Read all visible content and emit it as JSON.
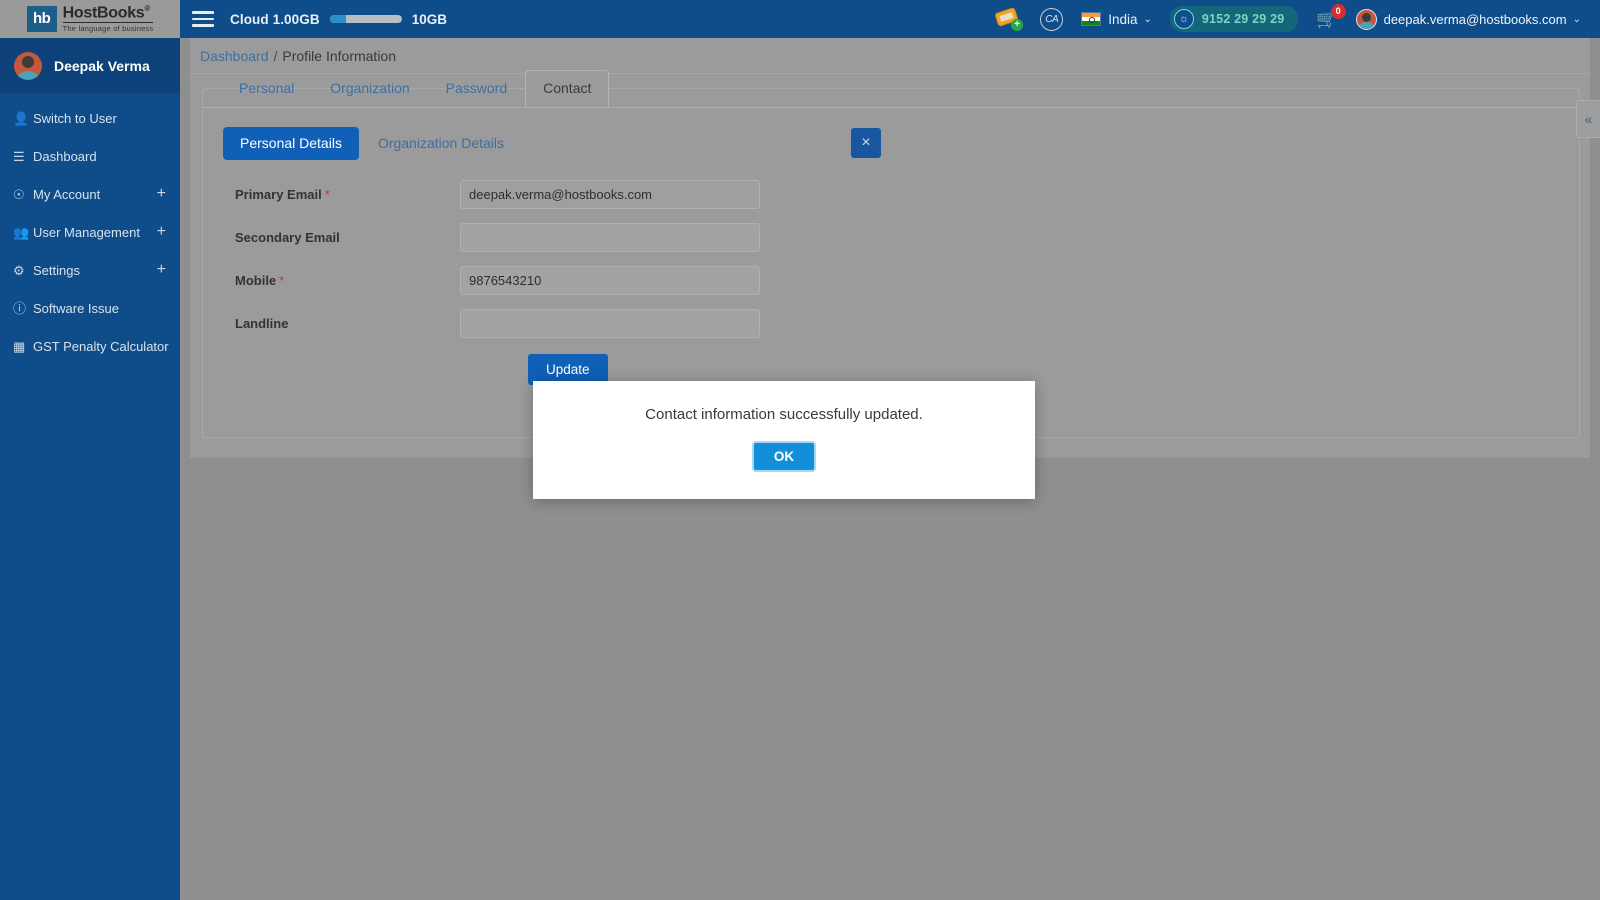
{
  "brand": {
    "mark": "hb",
    "name": "HostBooks",
    "registered": "®",
    "tagline": "The language of business"
  },
  "topbar": {
    "menu_toggle": "hamburger-menu",
    "cloud_label": "Cloud 1.00GB",
    "cloud_used_gb": 1.0,
    "cloud_total_label": "10GB",
    "cloud_total_gb": 10,
    "ticket_icon": "ticket-add-icon",
    "ca_badge": "CA",
    "country": "India",
    "country_caret": "⌄",
    "support_phone": "9152 29 29 29",
    "cart_count": "0",
    "user_email": "deepak.verma@hostbooks.com",
    "user_caret": "⌄"
  },
  "sidebar": {
    "profile_name": "Deepak Verma",
    "items": [
      {
        "label": "Switch to User",
        "icon": "user-icon",
        "glyph": "♟",
        "expandable": false
      },
      {
        "label": "Dashboard",
        "icon": "dashboard-icon",
        "glyph": "≡",
        "expandable": false
      },
      {
        "label": "My Account",
        "icon": "account-circle-icon",
        "glyph": "◉",
        "expandable": true
      },
      {
        "label": "User Management",
        "icon": "users-group-icon",
        "glyph": "⛃",
        "expandable": true
      },
      {
        "label": "Settings",
        "icon": "gear-icon",
        "glyph": "⚙",
        "expandable": true
      },
      {
        "label": "Software Issue",
        "icon": "info-circle-icon",
        "glyph": "ⓘ",
        "expandable": false
      },
      {
        "label": "GST Penalty Calculator",
        "icon": "calculator-icon",
        "glyph": "▦",
        "expandable": false
      }
    ],
    "plus_glyph": "+"
  },
  "breadcrumb": {
    "root": "Dashboard",
    "separator": "/",
    "current": "Profile Information"
  },
  "tabs": [
    {
      "label": "Personal",
      "active": false
    },
    {
      "label": "Organization",
      "active": false
    },
    {
      "label": "Password",
      "active": false
    },
    {
      "label": "Contact",
      "active": true
    }
  ],
  "subtabs": [
    {
      "label": "Personal Details",
      "active": true
    },
    {
      "label": "Organization Details",
      "active": false
    }
  ],
  "form": {
    "fields": [
      {
        "label": "Primary Email",
        "required": true,
        "value": "deepak.verma@hostbooks.com",
        "placeholder": "",
        "readonly": true
      },
      {
        "label": "Secondary Email",
        "required": false,
        "value": "",
        "placeholder": "",
        "readonly": false
      },
      {
        "label": "Mobile",
        "required": true,
        "value": "9876543210",
        "placeholder": "",
        "readonly": false
      },
      {
        "label": "Landline",
        "required": false,
        "value": "",
        "placeholder": "",
        "readonly": false
      }
    ],
    "required_marker": "*",
    "submit_label": "Update",
    "close_icon": "close-x-icon",
    "close_glyph": "×"
  },
  "collapse_handle": {
    "icon": "chevron-double-left-icon",
    "glyph": "«"
  },
  "modal": {
    "message": "Contact information successfully updated.",
    "ok_label": "OK"
  },
  "colors": {
    "brand_blue": "#0f4d8a",
    "accent_blue": "#1060b8",
    "modal_ok_blue": "#128fd9",
    "required_red": "#c0392b",
    "badge_red": "#d32f2f",
    "phone_teal": "#14667a",
    "link_blue": "#3e6fa3"
  }
}
